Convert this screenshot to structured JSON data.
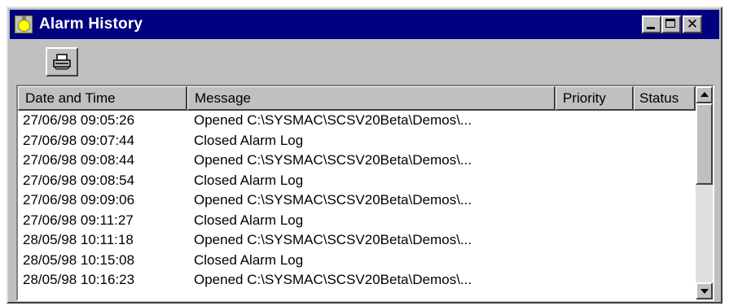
{
  "window": {
    "title": "Alarm History",
    "icon": "alarm-bell-icon",
    "buttons": [
      "minimize-icon",
      "maximize-icon",
      "close-icon"
    ],
    "close_glyph": "✕",
    "title_bar_color": "#000080",
    "face_color": "#c0c0c0"
  },
  "toolbar": {
    "print_icon": "printer-icon"
  },
  "table": {
    "columns": [
      "Date and Time",
      "Message",
      "Priority",
      "Status"
    ],
    "rows": [
      {
        "datetime": "27/06/98  09:05:26",
        "message": "Opened C:\\SYSMAC\\SCSV20Beta\\Demos\\...",
        "priority": "",
        "status": ""
      },
      {
        "datetime": "27/06/98  09:07:44",
        "message": "Closed Alarm Log",
        "priority": "",
        "status": ""
      },
      {
        "datetime": "27/06/98  09:08:44",
        "message": "Opened C:\\SYSMAC\\SCSV20Beta\\Demos\\...",
        "priority": "",
        "status": ""
      },
      {
        "datetime": "27/06/98  09:08:54",
        "message": "Closed Alarm Log",
        "priority": "",
        "status": ""
      },
      {
        "datetime": "27/06/98  09:09:06",
        "message": "Opened C:\\SYSMAC\\SCSV20Beta\\Demos\\...",
        "priority": "",
        "status": ""
      },
      {
        "datetime": "27/06/98  09:11:27",
        "message": "Closed Alarm Log",
        "priority": "",
        "status": ""
      },
      {
        "datetime": "28/05/98  10:11:18",
        "message": "Opened C:\\SYSMAC\\SCSV20Beta\\Demos\\...",
        "priority": "",
        "status": ""
      },
      {
        "datetime": "28/05/98  10:15:08",
        "message": "Closed Alarm Log",
        "priority": "",
        "status": ""
      },
      {
        "datetime": "28/05/98  10:16:23",
        "message": "Opened C:\\SYSMAC\\SCSV20Beta\\Demos\\...",
        "priority": "",
        "status": ""
      }
    ]
  },
  "scrollbar": {
    "up_icon": "scroll-up-arrow-icon",
    "down_icon": "scroll-down-arrow-icon"
  }
}
